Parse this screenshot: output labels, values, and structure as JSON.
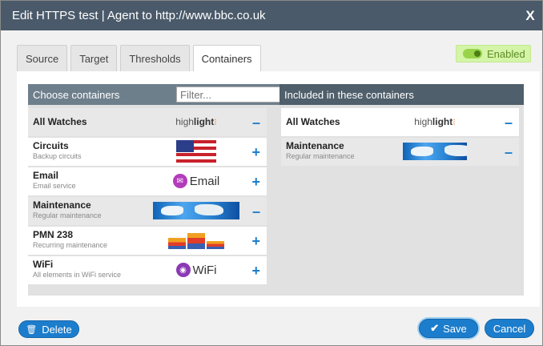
{
  "window": {
    "title": "Edit HTTPS test | Agent to http://www.bbc.co.uk",
    "close_label": "X"
  },
  "tabs": [
    {
      "label": "Source"
    },
    {
      "label": "Target"
    },
    {
      "label": "Thresholds"
    },
    {
      "label": "Containers",
      "active": true
    }
  ],
  "enabled_toggle": {
    "label": "Enabled",
    "on": true
  },
  "help_label": "?",
  "left_panel": {
    "title": "Choose containers",
    "filter_placeholder": "Filter...",
    "rows": [
      {
        "name": "All Watches",
        "sub": "",
        "logo": "highlight-logo",
        "logo_text_1": "high",
        "logo_text_2": "light",
        "action": "–",
        "selected": true
      },
      {
        "name": "Circuits",
        "sub": "Backup circuits",
        "logo": "us-flag",
        "action": "+"
      },
      {
        "name": "Email",
        "sub": "Email service",
        "logo": "email-logo",
        "logo_text": "Email",
        "action": "+"
      },
      {
        "name": "Maintenance",
        "sub": "Regular maintenance",
        "logo": "world-map",
        "action": "–",
        "selected": true
      },
      {
        "name": "PMN 238",
        "sub": "Recurring maintenance",
        "logo": "bar-chart",
        "action": "+"
      },
      {
        "name": "WiFi",
        "sub": "All elements in WiFi service",
        "logo": "wifi-logo",
        "logo_text": "WiFi",
        "action": "+"
      }
    ]
  },
  "right_panel": {
    "title": "Included in these containers",
    "rows": [
      {
        "name": "All Watches",
        "sub": "",
        "logo": "highlight-logo",
        "logo_text_1": "high",
        "logo_text_2": "light",
        "action": "–"
      },
      {
        "name": "Maintenance",
        "sub": "Regular maintenance",
        "logo": "world-map",
        "action": "–"
      }
    ]
  },
  "buttons": {
    "delete": "Delete",
    "save": "Save",
    "cancel": "Cancel"
  },
  "colors": {
    "accent": "#1c7dcc",
    "titlebar": "#4a5a6a",
    "enabled_bg": "#d4f5a7"
  }
}
